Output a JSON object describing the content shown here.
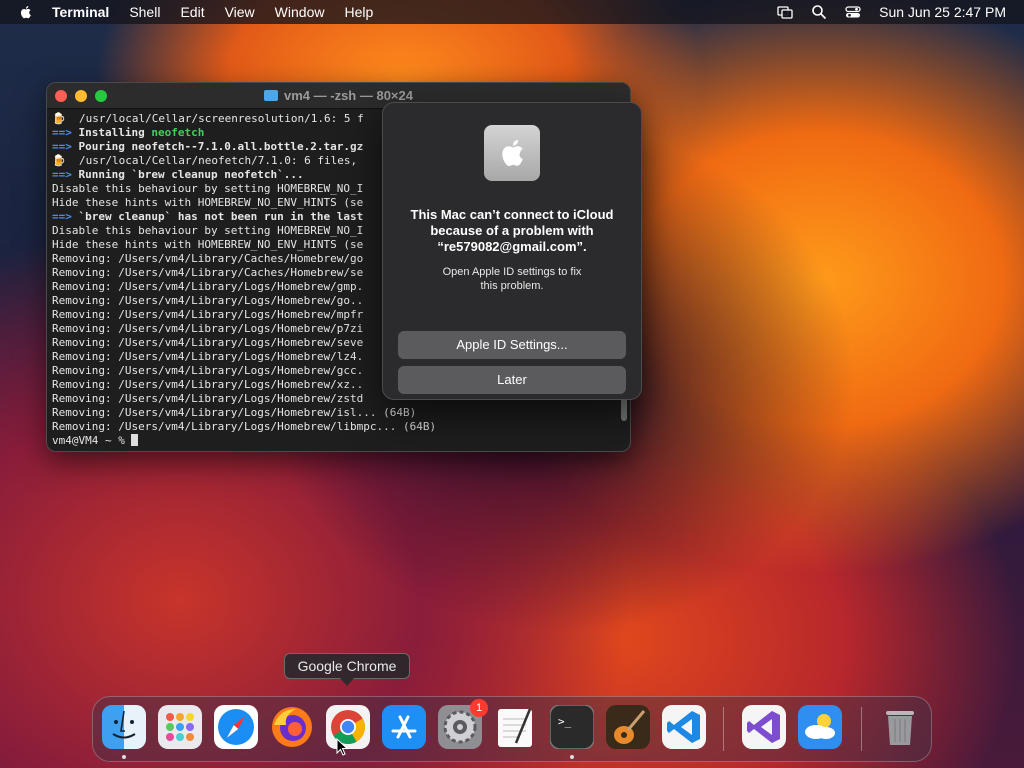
{
  "menubar": {
    "app_name": "Terminal",
    "items": [
      "Shell",
      "Edit",
      "View",
      "Window",
      "Help"
    ],
    "clock": "Sun Jun 25  2:47 PM"
  },
  "terminal": {
    "title": "vm4 — -zsh — 80×24",
    "lines": [
      {
        "prefix": "🍺",
        "prefix_type": "beer",
        "text": "  /usr/local/Cellar/screenresolution/1.6: 5 f"
      },
      {
        "prefix": "==>",
        "prefix_type": "arrow",
        "text": " Installing ",
        "extra": "neofetch",
        "extra_type": "green"
      },
      {
        "prefix": "==>",
        "prefix_type": "arrow",
        "text": " Pouring neofetch--7.1.0.all.bottle.2.tar.gz",
        "bold": true
      },
      {
        "prefix": "🍺",
        "prefix_type": "beer",
        "text": "  /usr/local/Cellar/neofetch/7.1.0: 6 files,"
      },
      {
        "prefix": "==>",
        "prefix_type": "arrow",
        "text": " Running `brew cleanup neofetch`...",
        "bold": true
      },
      {
        "prefix": "",
        "text": "Disable this behaviour by setting HOMEBREW_NO_I"
      },
      {
        "prefix": "",
        "text": "Hide these hints with HOMEBREW_NO_ENV_HINTS (se"
      },
      {
        "prefix": "==>",
        "prefix_type": "arrow",
        "text": " `brew cleanup` has not been run in the last",
        "bold": true
      },
      {
        "prefix": "",
        "text": "Disable this behaviour by setting HOMEBREW_NO_I"
      },
      {
        "prefix": "",
        "text": "Hide these hints with HOMEBREW_NO_ENV_HINTS (se"
      },
      {
        "prefix": "",
        "text": "Removing: /Users/vm4/Library/Caches/Homebrew/go"
      },
      {
        "prefix": "",
        "text": "Removing: /Users/vm4/Library/Caches/Homebrew/se"
      },
      {
        "prefix": "",
        "text": "Removing: /Users/vm4/Library/Logs/Homebrew/gmp."
      },
      {
        "prefix": "",
        "text": "Removing: /Users/vm4/Library/Logs/Homebrew/go.."
      },
      {
        "prefix": "",
        "text": "Removing: /Users/vm4/Library/Logs/Homebrew/mpfr"
      },
      {
        "prefix": "",
        "text": "Removing: /Users/vm4/Library/Logs/Homebrew/p7zi"
      },
      {
        "prefix": "",
        "text": "Removing: /Users/vm4/Library/Logs/Homebrew/seve"
      },
      {
        "prefix": "",
        "text": "Removing: /Users/vm4/Library/Logs/Homebrew/lz4."
      },
      {
        "prefix": "",
        "text": "Removing: /Users/vm4/Library/Logs/Homebrew/gcc."
      },
      {
        "prefix": "",
        "text": "Removing: /Users/vm4/Library/Logs/Homebrew/xz.."
      },
      {
        "prefix": "",
        "text": "Removing: /Users/vm4/Library/Logs/Homebrew/zstd"
      },
      {
        "prefix": "",
        "text": "Removing: /Users/vm4/Library/Logs/Homebrew/isl... (64B)"
      },
      {
        "prefix": "",
        "text": "Removing: /Users/vm4/Library/Logs/Homebrew/libmpc... (64B)"
      }
    ],
    "prompt": "vm4@VM4 ~ % "
  },
  "alert": {
    "title": "This Mac can’t connect to iCloud\nbecause of a problem with\n“re579082@gmail.com”.",
    "message": "Open Apple ID settings to fix\nthis problem.",
    "primary_button": "Apple ID Settings...",
    "secondary_button": "Later"
  },
  "tooltip": "Google Chrome",
  "dock": {
    "items": [
      {
        "name": "finder-icon",
        "running": true
      },
      {
        "name": "launchpad-icon",
        "running": false
      },
      {
        "name": "safari-icon",
        "running": false
      },
      {
        "name": "firefox-icon",
        "running": false
      },
      {
        "name": "chrome-icon",
        "running": false
      },
      {
        "name": "app-store-icon",
        "running": false
      },
      {
        "name": "system-settings-icon",
        "running": false,
        "badge": "1"
      },
      {
        "name": "textedit-icon",
        "running": false
      },
      {
        "name": "terminal-icon",
        "running": true
      },
      {
        "name": "garageband-icon",
        "running": false
      },
      {
        "name": "vscode-icon",
        "running": false
      },
      {
        "name": "visual-studio-icon",
        "running": false
      },
      {
        "name": "weather-icon",
        "running": false
      },
      {
        "name": "trash-icon",
        "running": false
      }
    ]
  }
}
